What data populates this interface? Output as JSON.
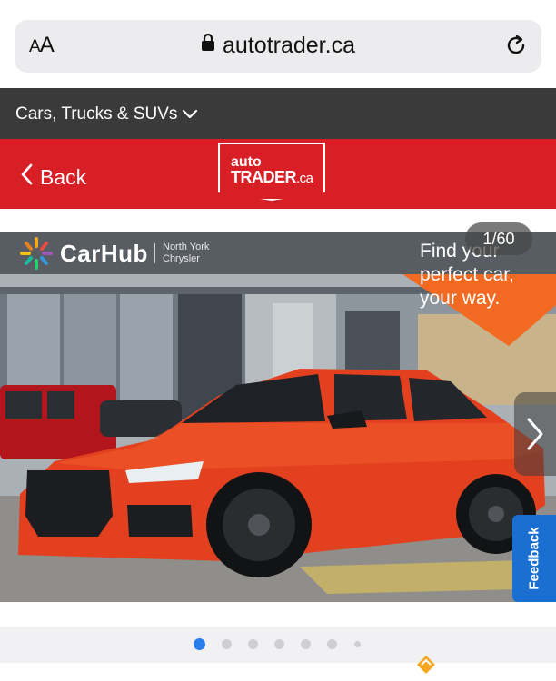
{
  "browser": {
    "text_size_label": "AA",
    "url": "autotrader.ca"
  },
  "category": {
    "label": "Cars, Trucks & SUVs"
  },
  "header": {
    "back_label": "Back",
    "logo_line1": "auto",
    "logo_line2": "TRADER",
    "logo_suffix": ".ca"
  },
  "gallery": {
    "dealer_name": "CarHub",
    "dealer_location_line1": "North York",
    "dealer_location_line2": "Chrysler",
    "promo_line1": "Find your",
    "promo_line2": "perfect car,",
    "promo_line3": "your way.",
    "counter": "1/60",
    "current_index": 1,
    "total": 60,
    "feedback_label": "Feedback"
  },
  "pagination": {
    "dot_count": 7,
    "active_index": 0
  },
  "colors": {
    "brand_red": "#d91f26",
    "category_bar": "#3a3a3a",
    "promo_orange": "#f26a21",
    "feedback_blue": "#1a6fd1",
    "active_dot": "#2b7de9"
  }
}
